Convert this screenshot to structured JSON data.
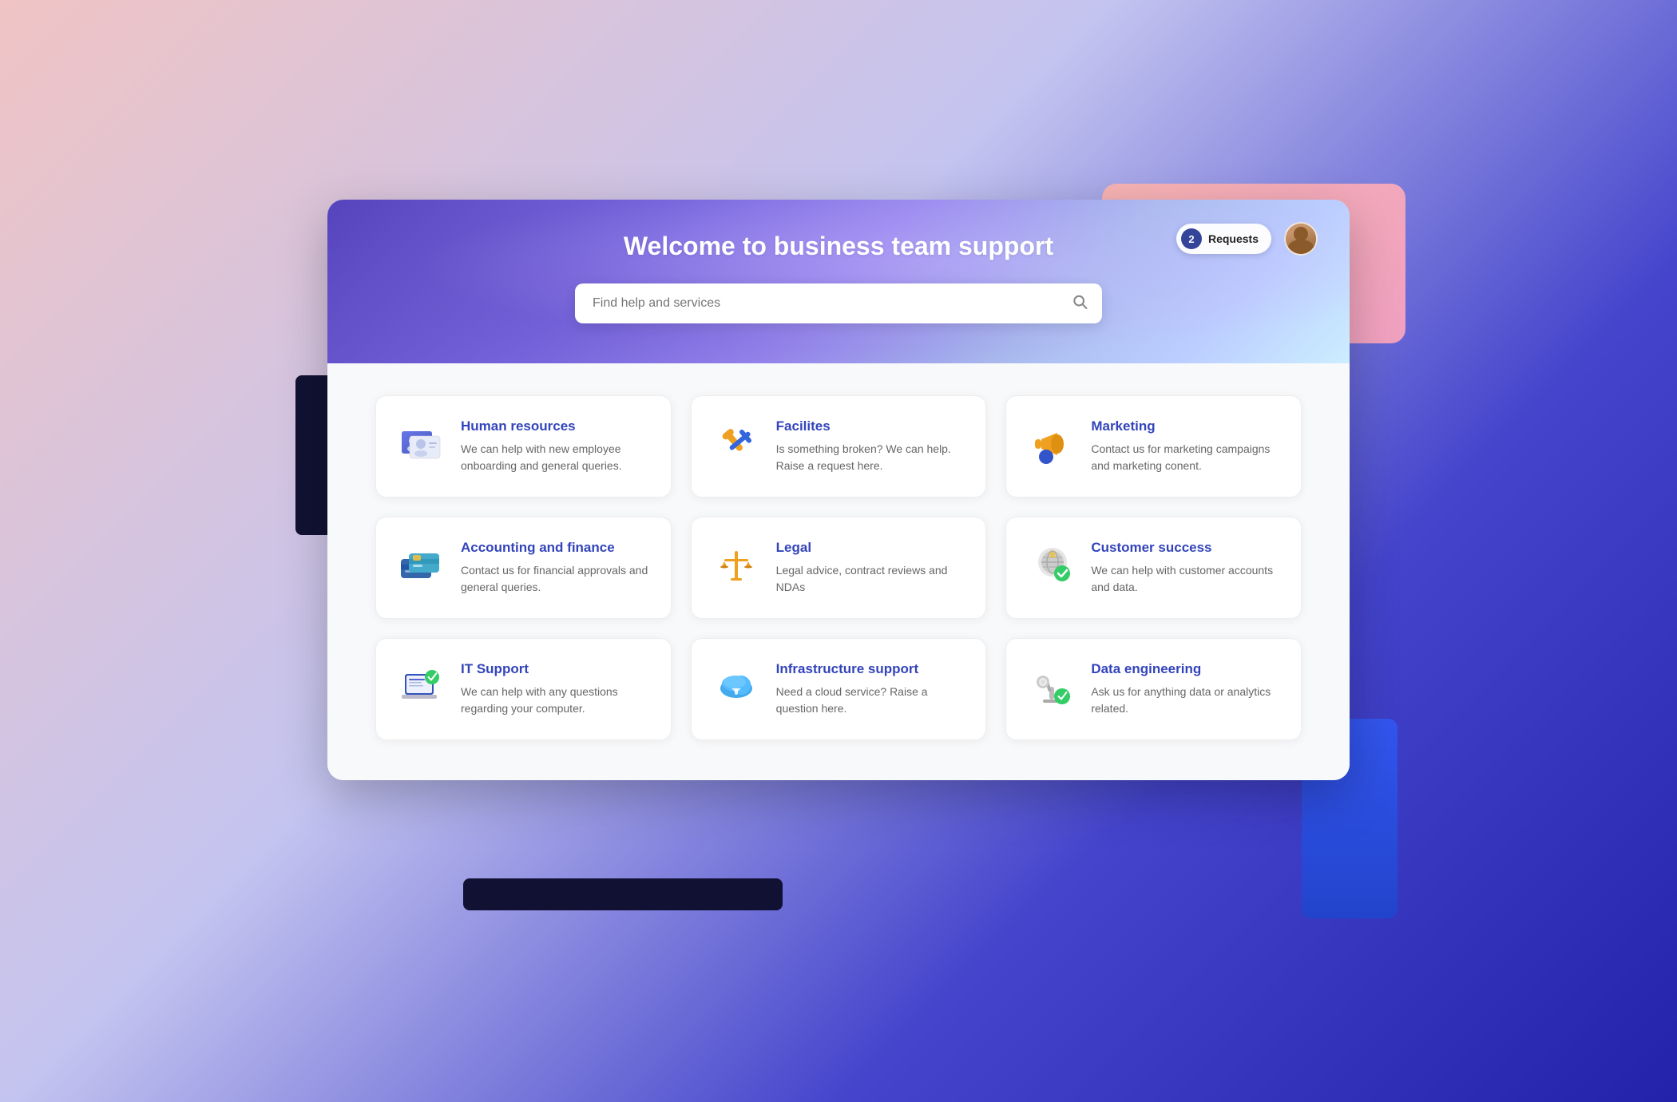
{
  "header": {
    "title": "Welcome to business team support",
    "search_placeholder": "Find help and services",
    "requests_count": "2",
    "requests_label": "Requests"
  },
  "services": [
    {
      "id": "human-resources",
      "title": "Human resources",
      "description": "We can help with new employee onboarding and general queries.",
      "icon": "hr"
    },
    {
      "id": "facilities",
      "title": "Facilites",
      "description": "Is something broken? We can help. Raise a request here.",
      "icon": "facilities"
    },
    {
      "id": "marketing",
      "title": "Marketing",
      "description": "Contact us for marketing campaigns and marketing conent.",
      "icon": "marketing"
    },
    {
      "id": "accounting-finance",
      "title": "Accounting and finance",
      "description": "Contact us for financial approvals and general queries.",
      "icon": "accounting"
    },
    {
      "id": "legal",
      "title": "Legal",
      "description": "Legal advice, contract reviews and NDAs",
      "icon": "legal"
    },
    {
      "id": "customer-success",
      "title": "Customer success",
      "description": "We can help with customer accounts and data.",
      "icon": "customer-success"
    },
    {
      "id": "it-support",
      "title": "IT Support",
      "description": "We can help with any questions regarding your computer.",
      "icon": "it-support"
    },
    {
      "id": "infrastructure-support",
      "title": "Infrastructure support",
      "description": "Need a cloud service? Raise a question here.",
      "icon": "infrastructure"
    },
    {
      "id": "data-engineering",
      "title": "Data engineering",
      "description": "Ask us for anything data or analytics related.",
      "icon": "data-engineering"
    }
  ]
}
